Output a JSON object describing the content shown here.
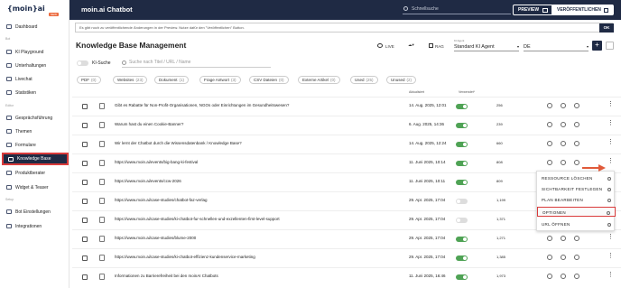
{
  "sidebar": {
    "logo": "{moin}ai",
    "logo_badge": "NEW",
    "sections": [
      "Bot",
      "Editor",
      "Setup"
    ],
    "items": [
      {
        "label": "Dashboard",
        "icon": "dashboard-icon"
      },
      {
        "label": "KI Playground",
        "icon": "playground-icon"
      },
      {
        "label": "Unterhaltungen",
        "icon": "chat-icon"
      },
      {
        "label": "Livechat",
        "icon": "livechat-icon"
      },
      {
        "label": "Statistiken",
        "icon": "stats-icon"
      },
      {
        "label": "Gesprächsführung",
        "icon": "flow-icon"
      },
      {
        "label": "Themen",
        "icon": "topics-icon"
      },
      {
        "label": "Formulare",
        "icon": "forms-icon"
      },
      {
        "label": "Knowledge Base",
        "icon": "knowledge-icon"
      },
      {
        "label": "Produktberater",
        "icon": "advisor-icon"
      },
      {
        "label": "Widget & Teaser",
        "icon": "widget-icon"
      },
      {
        "label": "Bot Einstellungen",
        "icon": "settings-icon"
      },
      {
        "label": "Integrationen",
        "icon": "integrations-icon"
      }
    ]
  },
  "topbar": {
    "title": "moin.ai Chatbot",
    "search_placeholder": "Schnellsuche",
    "preview": "PREVIEW",
    "publish": "VERÖFFENTLICHEN"
  },
  "notice": {
    "text": "Es gibt noch zu veröffentlichende Änderungen in der Preview. Nutze dafür den \"Veröffentlichen\" Button.",
    "ok": "OK"
  },
  "header": {
    "title": "Knowledge Base Management",
    "live": "LIVE",
    "rag": "RAG",
    "agent_label": "KI Agent",
    "agent_value": "Standard KI Agent",
    "lang_value": "DE",
    "plus": "+"
  },
  "search": {
    "toggle_label": "KI-Suche",
    "placeholder": "Suche nach Titel / URL / Name"
  },
  "chips": [
    {
      "label": "PDF",
      "count": "(0)"
    },
    {
      "label": "Websites",
      "count": "(23)"
    },
    {
      "label": "Dokument",
      "count": "(1)"
    },
    {
      "label": "Frage Antwort",
      "count": "(3)"
    },
    {
      "label": "CSV Dateien",
      "count": "(0)"
    },
    {
      "label": "Externe Artikel",
      "count": "(0)"
    },
    {
      "label": "Used",
      "count": "(25)"
    },
    {
      "label": "Unused",
      "count": "(2)"
    }
  ],
  "table": {
    "col_updated": "Aktualisiert",
    "col_used": "Verwendet*",
    "rows": [
      {
        "title": "Gibt es Rabatte für Non-Profit-Organisationen, NGOs oder Einrichtungen im Gesundheitswesen?",
        "date": "14. Aug. 2025, 12:01",
        "num": "256",
        "on": true
      },
      {
        "title": "Warum hast du einen Cookie-Banner?",
        "date": "6. Aug. 2025, 14:36",
        "num": "239",
        "on": true
      },
      {
        "title": "Wir lernt der Chatbot durch die Wissensdatenbank / Knowledge Base?",
        "date": "14. Aug. 2025, 12:24",
        "num": "660",
        "on": true
      },
      {
        "title": "https://www.moin.ai/events/big-bang-ki-festival",
        "date": "11. Juni 2025, 10:14",
        "num": "808",
        "on": true
      },
      {
        "title": "https://www.moin.ai/events/ccw-2026",
        "date": "11. Juni 2025, 10:11",
        "num": "809",
        "on": true
      },
      {
        "title": "https://www.moin.ai/case-studies/chatbot-faz-verlag",
        "date": "29. Apr. 2025, 17:04",
        "num": "1,199",
        "on": false
      },
      {
        "title": "https://www.moin.ai/case-studies/ki-chatbot-fur-schnellen-und-exzellenten-first-level-support",
        "date": "29. Apr. 2025, 17:04",
        "num": "1,371",
        "on": false
      },
      {
        "title": "https://www.moin.ai/case-studies/blume-2000",
        "date": "29. Apr. 2025, 17:04",
        "num": "1,271",
        "on": true
      },
      {
        "title": "https://www.moin.ai/case-studies/ki-chatbot-effizienz-kundenservice-marketing",
        "date": "29. Apr. 2025, 17:04",
        "num": "1,385",
        "on": true
      },
      {
        "title": "Informationen zu Barrierefreiheit bei den moinAI Chatbots",
        "date": "11. Juni 2025, 16:46",
        "num": "1,973",
        "on": true
      }
    ]
  },
  "menu": {
    "items": [
      "RESSOURCE LÖSCHEN",
      "SICHTBARKEIT FESTLEGEN",
      "PLAN BEARBEITEN",
      "OPTIONEN",
      "URL ÖFFNEN"
    ]
  },
  "colors": {
    "nav_dark": "#1f2a44",
    "toggle_on": "#4fa355",
    "highlight": "#d93b3b",
    "arrow": "#e05a3a"
  }
}
